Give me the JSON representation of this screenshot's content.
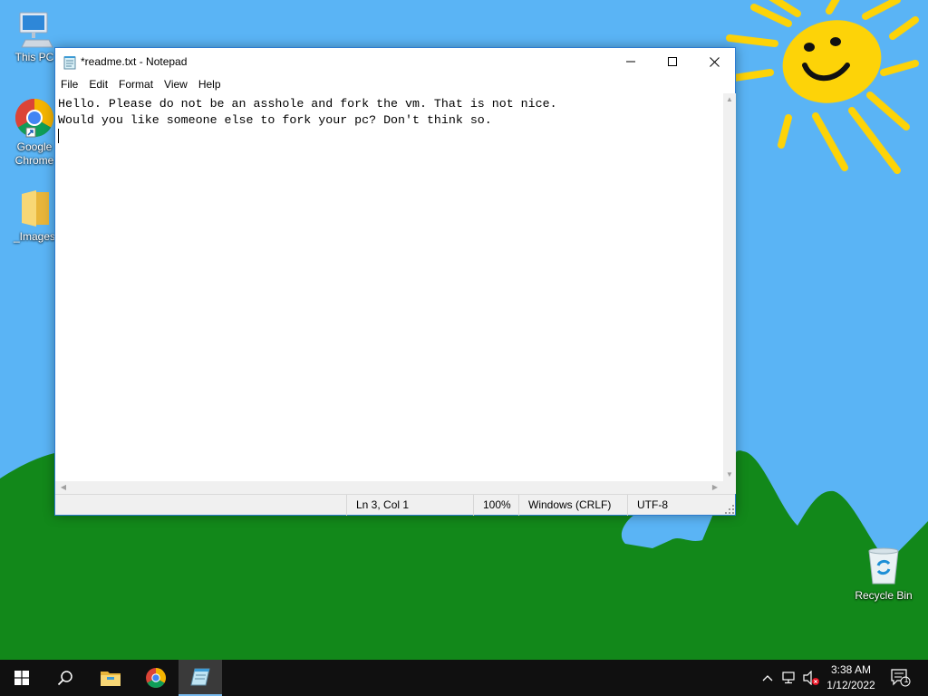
{
  "desktop": {
    "icons": [
      {
        "label": "This PC",
        "icon": "monitor-icon"
      },
      {
        "label": "Google Chrome",
        "icon": "chrome-icon"
      },
      {
        "label": "_Images",
        "icon": "folder-icon"
      },
      {
        "label": "Recycle Bin",
        "icon": "recycle-bin-icon"
      }
    ]
  },
  "window": {
    "title": "*readme.txt - Notepad",
    "app_icon": "notepad-icon",
    "controls": [
      "minimize-icon",
      "maximize-icon",
      "close-icon"
    ]
  },
  "menu": {
    "items": [
      "File",
      "Edit",
      "Format",
      "View",
      "Help"
    ]
  },
  "editor": {
    "lines": [
      "Hello. Please do not be an asshole and fork the vm. That is not nice.",
      "Would you like someone else to fork your pc? Don't think so.",
      ""
    ]
  },
  "status": {
    "position": "Ln 3, Col 1",
    "zoom": "100%",
    "line_ending": "Windows (CRLF)",
    "encoding": "UTF-8"
  },
  "taskbar": {
    "apps": [
      "start-icon",
      "search-icon",
      "file-explorer-icon",
      "chrome-icon",
      "notepad-icon"
    ],
    "tray": [
      "chevron-up-icon",
      "network-icon",
      "volume-muted-icon",
      "notifications-icon"
    ],
    "time": "3:38 AM",
    "date": "1/12/2022",
    "notification_count": "1"
  },
  "colors": {
    "sky": "#5ab4f5",
    "hills": "#12881a",
    "sun": "#fdd308",
    "taskbar": "#101010",
    "window_border": "#2b7bd1"
  }
}
